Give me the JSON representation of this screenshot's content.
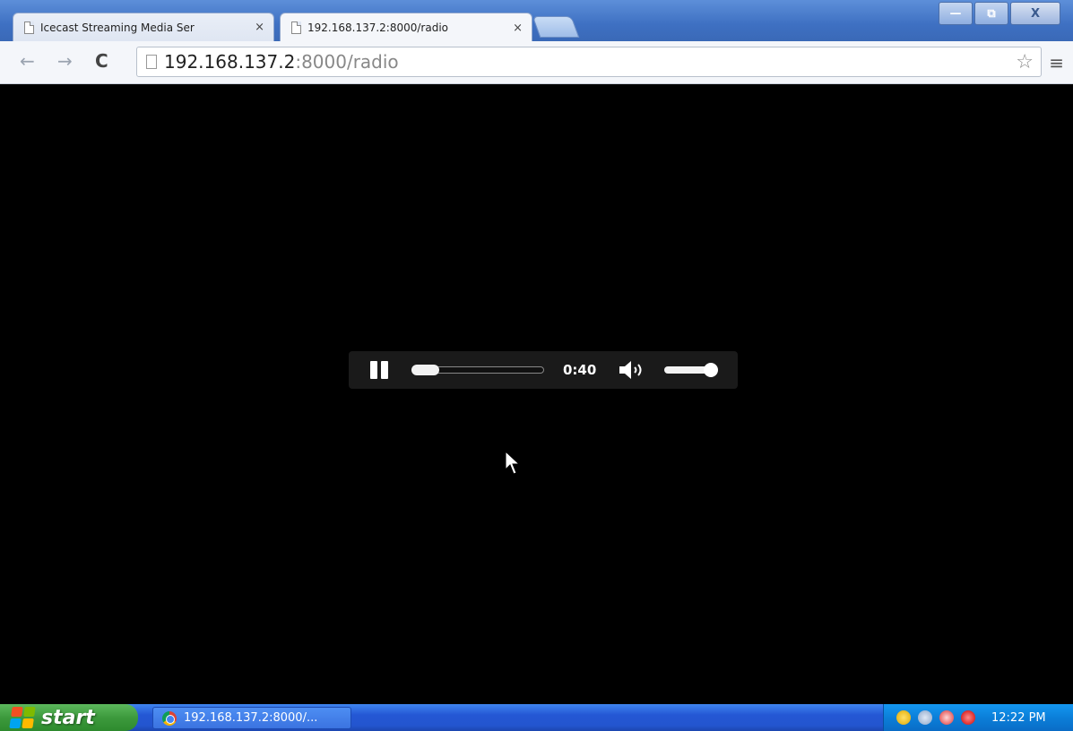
{
  "browser": {
    "tabs": [
      {
        "title": "Icecast Streaming Media Ser",
        "close": "×",
        "active": false
      },
      {
        "title": "192.168.137.2:8000/radio",
        "close": "×",
        "active": true
      }
    ],
    "window_buttons": {
      "minimize": "—",
      "maximize": "⧉",
      "close": "X"
    },
    "nav": {
      "back": "←",
      "forward": "→",
      "reload": "C"
    },
    "url_host": "192.168.137.2",
    "url_rest": ":8000/radio",
    "bookmark_star": "☆",
    "menu_icon": "≡"
  },
  "player": {
    "state": "playing",
    "time": "0:40",
    "seek_progress": 0.18,
    "volume_level": 1.0
  },
  "taskbar": {
    "start_label": "start",
    "task_label": "192.168.137.2:8000/...",
    "clock": "12:22 PM",
    "tray_icons": [
      "security-shield-icon",
      "network-icon",
      "update-icon",
      "alert-icon"
    ]
  },
  "colors": {
    "page_background": "#000000",
    "player_background": "#1a1a1a",
    "taskbar_blue": "#2457d4",
    "start_green": "#3d9a3d"
  }
}
